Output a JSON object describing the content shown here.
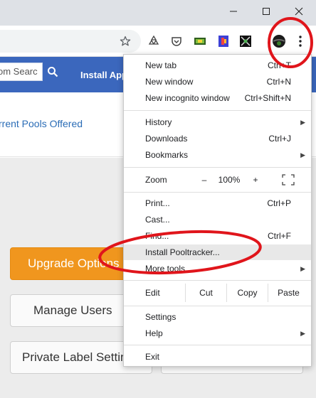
{
  "window": {
    "minimize_icon": "minimize-icon",
    "maximize_icon": "maximize-icon",
    "close_icon": "close-icon"
  },
  "toolbar": {
    "icons": [
      "star-icon",
      "recycle-icon",
      "pocket-icon",
      "green-extension-icon",
      "blue-extension-icon",
      "dark-extension-icon",
      "profile-avatar",
      "kebab-menu-icon"
    ]
  },
  "page": {
    "search_placeholder": "om Searc",
    "install_app": "Install App",
    "pools_link": "rrent Pools Offered",
    "upgrade_button": "Upgrade Options",
    "manage_users_button": "Manage Users",
    "private_label_button": "Private Label Settings"
  },
  "menu": {
    "new_tab": {
      "label": "New tab",
      "shortcut": "Ctrl+T"
    },
    "new_window": {
      "label": "New window",
      "shortcut": "Ctrl+N"
    },
    "new_incognito": {
      "label": "New incognito window",
      "shortcut": "Ctrl+Shift+N"
    },
    "history": {
      "label": "History"
    },
    "downloads": {
      "label": "Downloads",
      "shortcut": "Ctrl+J"
    },
    "bookmarks": {
      "label": "Bookmarks"
    },
    "zoom": {
      "label": "Zoom",
      "minus": "–",
      "value": "100%",
      "plus": "+"
    },
    "print": {
      "label": "Print...",
      "shortcut": "Ctrl+P"
    },
    "cast": {
      "label": "Cast..."
    },
    "find": {
      "label": "Find...",
      "shortcut": "Ctrl+F"
    },
    "install": {
      "label": "Install Pooltracker..."
    },
    "more_tools": {
      "label": "More tools"
    },
    "edit": {
      "label": "Edit",
      "cut": "Cut",
      "copy": "Copy",
      "paste": "Paste"
    },
    "settings": {
      "label": "Settings"
    },
    "help": {
      "label": "Help"
    },
    "exit": {
      "label": "Exit"
    }
  },
  "colors": {
    "annotation": "#e0151b",
    "navbar": "#3b67bd",
    "upgrade": "#f0961e",
    "link": "#2a6cb6"
  }
}
